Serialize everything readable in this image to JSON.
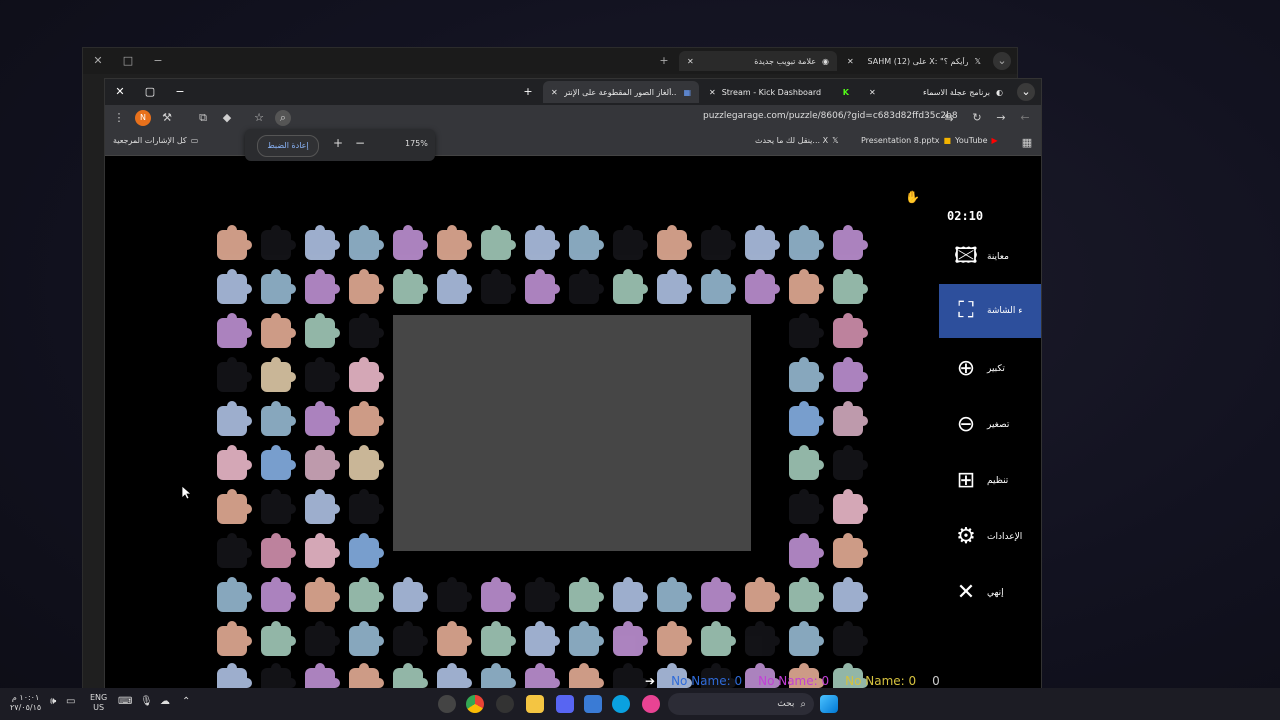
{
  "back_window": {
    "tabs": [
      {
        "label": "علامة تبويب جديدة"
      },
      {
        "label": "SAHM (12) على X: \"رأيكم ؟"
      }
    ]
  },
  "front_window": {
    "tabs": [
      {
        "label": "ألغاز الصور المقطوعة على الإنتر..."
      },
      {
        "label": "Stream - Kick Dashboard"
      },
      {
        "label": "برنامج عجلة الاسماء"
      }
    ],
    "url": "puzzlegarage.com/puzzle/8606/?gid=c683d82ffd35c2b8",
    "zoom": {
      "reset_label": "إعادة الضبط",
      "level": "175%"
    },
    "bookmarks": [
      {
        "label": "كل الإشارات المرجعية"
      },
      {
        "label": "ينقل لك ما يحدث... X"
      },
      {
        "label": "Presentation 8.pptx"
      },
      {
        "label": "YouTube"
      }
    ]
  },
  "game": {
    "timer": "02:10",
    "sidebar": [
      {
        "label": "معاينة",
        "icon": "image-icon"
      },
      {
        "label": "ء الشاشة",
        "icon": "fullscreen-icon"
      },
      {
        "label": "تكبير",
        "icon": "zoom-in-icon"
      },
      {
        "label": "تصغير",
        "icon": "zoom-out-icon"
      },
      {
        "label": "تنظيم",
        "icon": "grid-icon"
      },
      {
        "label": "الإعدادات",
        "icon": "gear-icon"
      },
      {
        "label": "إنهي",
        "icon": "close-icon"
      }
    ],
    "players": [
      {
        "name": "No Name: 0",
        "color": "#2f6bd8"
      },
      {
        "name": "No Name: 0",
        "color": "#c23fd6"
      },
      {
        "name": "No Name: 0",
        "color": "#d6c23f"
      },
      {
        "name": "0",
        "color": "#cccccc"
      }
    ]
  },
  "taskbar": {
    "search": "بحث",
    "lang": "ENG",
    "region": "US",
    "time": "١٠:٠١ م",
    "date": "٢٧/٠٥/١٥"
  }
}
